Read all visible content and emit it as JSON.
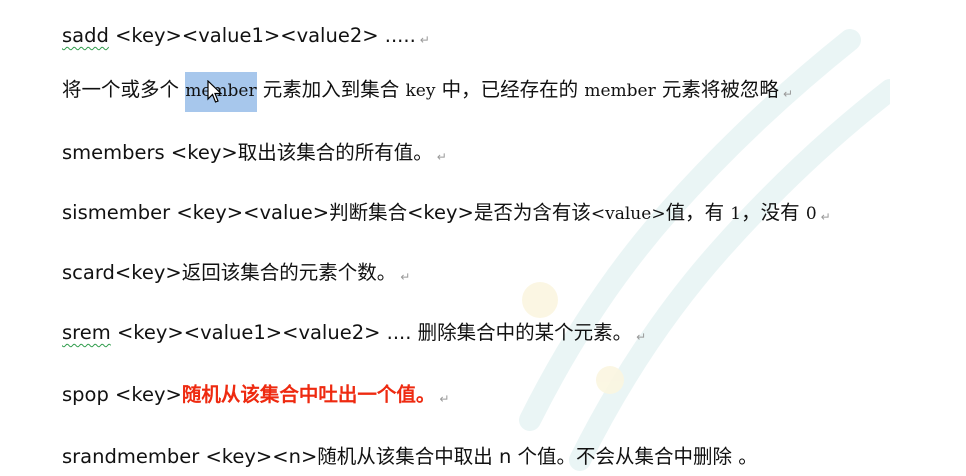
{
  "lines": [
    {
      "cmd": "sadd",
      "rest": " <key><value1><value2> .....",
      "mark": "↵"
    },
    {
      "before": "将一个或多个 ",
      "selected": "member",
      "mid": " 元素加入到集合 ",
      "key": "key",
      "after1": " 中，已经存在的 ",
      "member2": "member",
      "after2": " 元素将被忽略",
      "mark": "↵"
    },
    {
      "text": "smembers <key>取出该集合的所有值。",
      "mark": "↵"
    },
    {
      "before": "sismember <key><value>判断集合<key>是否为含有该",
      "value": "<value>",
      "mid": "值，有 ",
      "one": "1",
      "mid2": "，没有 ",
      "zero": "0",
      "mark": "↵"
    },
    {
      "text": "scard<key>返回该集合的元素个数。",
      "mark": "↵"
    },
    {
      "cmd": "srem",
      "rest": " <key><value1><value2> .... 删除集合中的某个元素。",
      "mark": "↵"
    },
    {
      "before": "spop <key>",
      "red": "随机从该集合中吐出一个值。",
      "mark": "↵"
    },
    {
      "text": "srandmember <key><n>随机从该集合中取出 n 个值。不会从集合中删除 。",
      "mark": "↵"
    }
  ],
  "colors": {
    "text": "#111111",
    "highlight": "#ee2a10",
    "selection": "#a7c7ec",
    "squiggle": "#2e9b4a"
  },
  "icons": {
    "cursor": "arrow-cursor-icon",
    "paragraph_mark": "return-mark-icon"
  }
}
